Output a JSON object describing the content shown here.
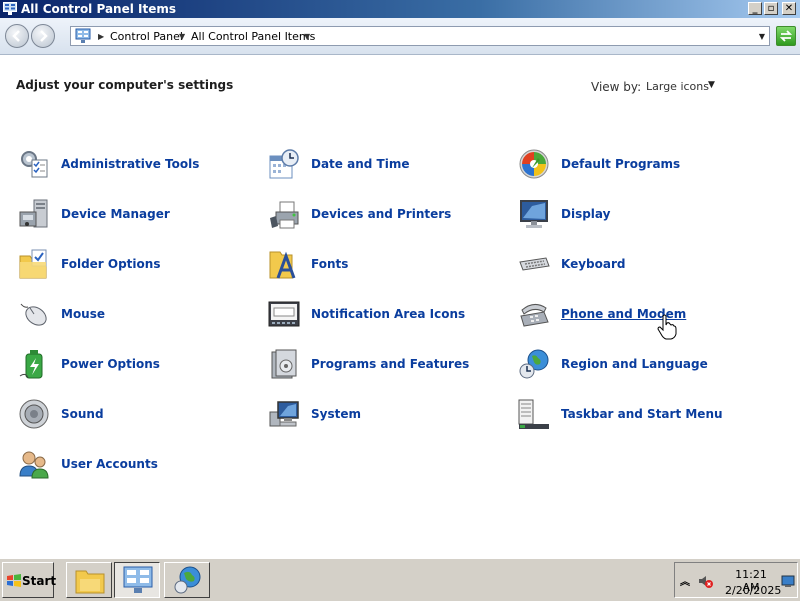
{
  "window": {
    "title": "All Control Panel Items"
  },
  "address": {
    "crumbs": [
      "Control Panel",
      "All Control Panel Items"
    ]
  },
  "content": {
    "heading": "Adjust your computer's settings",
    "view_by_label": "View by:",
    "view_by_value": "Large icons"
  },
  "items": [
    {
      "label": "Administrative Tools",
      "icon": "administrative-tools-icon"
    },
    {
      "label": "Date and Time",
      "icon": "date-time-icon"
    },
    {
      "label": "Default Programs",
      "icon": "default-programs-icon"
    },
    {
      "label": "Device Manager",
      "icon": "device-manager-icon"
    },
    {
      "label": "Devices and Printers",
      "icon": "devices-printers-icon"
    },
    {
      "label": "Display",
      "icon": "display-icon"
    },
    {
      "label": "Folder Options",
      "icon": "folder-options-icon"
    },
    {
      "label": "Fonts",
      "icon": "fonts-icon"
    },
    {
      "label": "Keyboard",
      "icon": "keyboard-icon"
    },
    {
      "label": "Mouse",
      "icon": "mouse-icon"
    },
    {
      "label": "Notification Area Icons",
      "icon": "notification-area-icon"
    },
    {
      "label": "Phone and Modem",
      "icon": "phone-modem-icon"
    },
    {
      "label": "Power Options",
      "icon": "power-options-icon"
    },
    {
      "label": "Programs and Features",
      "icon": "programs-features-icon"
    },
    {
      "label": "Region and Language",
      "icon": "region-language-icon"
    },
    {
      "label": "Sound",
      "icon": "sound-icon"
    },
    {
      "label": "System",
      "icon": "system-icon"
    },
    {
      "label": "Taskbar and Start Menu",
      "icon": "taskbar-start-menu-icon"
    },
    {
      "label": "User Accounts",
      "icon": "user-accounts-icon"
    }
  ],
  "taskbar": {
    "start_label": "Start",
    "time": "11:21 AM",
    "date": "2/20/2025"
  },
  "colors": {
    "link": "#0a3d9e",
    "titlebar": "#0a246a"
  }
}
